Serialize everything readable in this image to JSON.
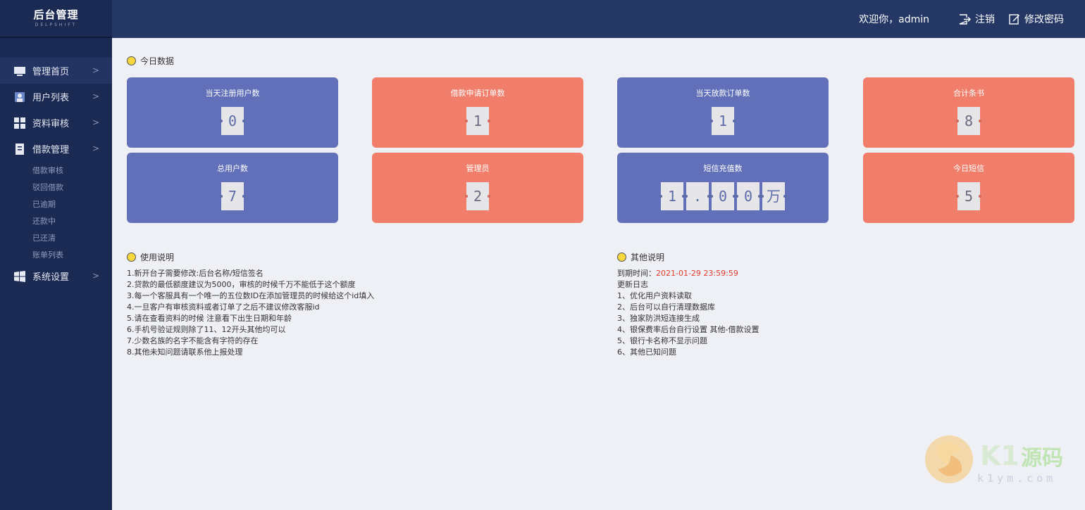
{
  "logo": {
    "title": "后台管理",
    "subtitle": "DELPSHIFT"
  },
  "header": {
    "welcome": "欢迎你，admin",
    "logout": "注销",
    "change_password": "修改密码"
  },
  "sidebar": {
    "items": [
      {
        "label": "管理首页",
        "icon": "monitor-icon"
      },
      {
        "label": "用户列表",
        "icon": "user-icon"
      },
      {
        "label": "资料审核",
        "icon": "grid-icon"
      },
      {
        "label": "借款管理",
        "icon": "document-icon"
      }
    ],
    "subitems": [
      "借款审核",
      "驳回借款",
      "已逾期",
      "还款中",
      "已还清",
      "账单列表"
    ],
    "settings": {
      "label": "系统设置",
      "icon": "windows-icon"
    }
  },
  "today": {
    "title": "今日数据",
    "cards": [
      {
        "title": "当天注册用户数",
        "digits": [
          "0"
        ],
        "color": "blue"
      },
      {
        "title": "借款申请订单数",
        "digits": [
          "1"
        ],
        "color": "red"
      },
      {
        "title": "当天放款订单数",
        "digits": [
          "1"
        ],
        "color": "blue"
      },
      {
        "title": "合计条书",
        "digits": [
          "8"
        ],
        "color": "red"
      },
      {
        "title": "总用户数",
        "digits": [
          "7"
        ],
        "color": "blue"
      },
      {
        "title": "管理员",
        "digits": [
          "2"
        ],
        "color": "red"
      },
      {
        "title": "短信充值数",
        "digits": [
          "1",
          ".",
          "0",
          "0",
          "万"
        ],
        "color": "blue"
      },
      {
        "title": "今日短信",
        "digits": [
          "5"
        ],
        "color": "red"
      }
    ]
  },
  "usage": {
    "title": "使用说明",
    "lines": [
      "1.新开台子需要修改:后台名称/短信签名",
      "2.贷款的最低额度建议为5000，审核的时候千万不能低于这个额度",
      "3.每一个客服具有一个唯一的五位数ID在添加管理员的时候给这个id填入",
      "4.一旦客户有审核资料或者订单了之后不建议修改客服id",
      "5.请在查看资料的时候 注意看下出生日期和年龄",
      "6.手机号验证规则除了11、12开头其他均可以",
      "7.少数名族的名字不能含有字符的存在",
      "8.其他未知问题请联系他上报处理"
    ]
  },
  "other": {
    "title": "其他说明",
    "expire_label": "到期时间：",
    "expire_value": "2021-01-29 23:59:59",
    "log_title": "更新日志",
    "lines": [
      "1、优化用户资料读取",
      "2、后台可以自行清理数据库",
      "3、独家防洪短连接生成",
      "4、银保费率后台自行设置 其他-借款设置",
      "5、银行卡名称不显示问题",
      "6、其他已知问题"
    ]
  },
  "watermark": {
    "brand": "K1源码",
    "url": "k1ym.com"
  },
  "colors": {
    "blue_card": "#6170b8",
    "red_card": "#f07e6b",
    "sidebar": "#1b2a52",
    "header": "#243765"
  }
}
